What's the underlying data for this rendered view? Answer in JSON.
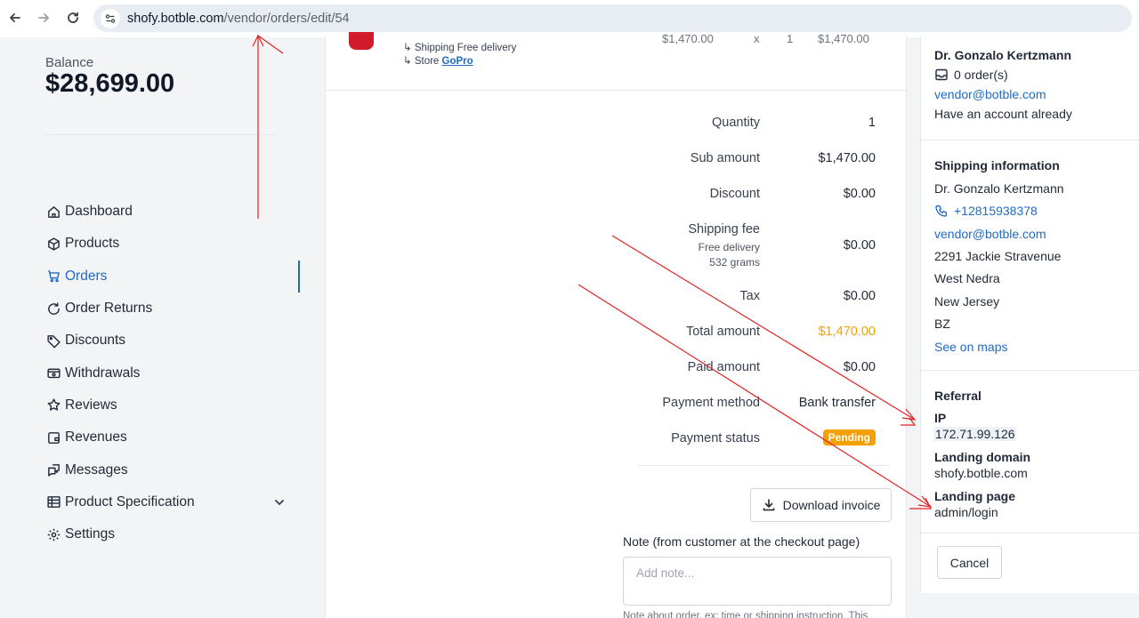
{
  "browser": {
    "url_host": "shofy.botble.com",
    "url_path": "/vendor/orders/edit/54"
  },
  "sidebar": {
    "balance_label": "Balance",
    "balance_value": "$28,699.00",
    "items": [
      {
        "label": "Dashboard",
        "icon": "home-icon"
      },
      {
        "label": "Products",
        "icon": "package-icon"
      },
      {
        "label": "Orders",
        "icon": "cart-icon",
        "active": true
      },
      {
        "label": "Order Returns",
        "icon": "return-icon"
      },
      {
        "label": "Discounts",
        "icon": "tag-icon"
      },
      {
        "label": "Withdrawals",
        "icon": "wallet-icon"
      },
      {
        "label": "Reviews",
        "icon": "star-icon"
      },
      {
        "label": "Revenues",
        "icon": "revenue-icon"
      },
      {
        "label": "Messages",
        "icon": "messages-icon"
      },
      {
        "label": "Product Specification",
        "icon": "table-icon"
      },
      {
        "label": "Settings",
        "icon": "gear-icon"
      }
    ]
  },
  "product": {
    "shipping_line": "↳ Shipping Free delivery",
    "store_prefix": "↳ Store",
    "store_name": "GoPro",
    "cut_price": "$1,470.00",
    "cut_times": "x",
    "cut_qty": "1",
    "cut_total": "$1,470.00"
  },
  "summary": {
    "quantity_label": "Quantity",
    "quantity_value": "1",
    "sub_amount_label": "Sub amount",
    "sub_amount_value": "$1,470.00",
    "discount_label": "Discount",
    "discount_value": "$0.00",
    "shipping_fee_label": "Shipping fee",
    "shipping_method": "Free delivery",
    "shipping_weight": "532 grams",
    "shipping_fee_value": "$0.00",
    "tax_label": "Tax",
    "tax_value": "$0.00",
    "total_label": "Total amount",
    "total_value": "$1,470.00",
    "paid_label": "Paid amount",
    "paid_value": "$0.00",
    "payment_method_label": "Payment method",
    "payment_method_value": "Bank transfer",
    "payment_status_label": "Payment status",
    "payment_status_value": "Pending"
  },
  "actions": {
    "download_invoice": "Download invoice",
    "note_label": "Note (from customer at the checkout page)",
    "note_placeholder": "Add note...",
    "note_help": "Note about order, ex: time or shipping instruction. This",
    "cancel": "Cancel"
  },
  "customer": {
    "name": "Dr. Gonzalo Kertzmann",
    "orders": "0 order(s)",
    "email": "vendor@botble.com",
    "account_status": "Have an account already"
  },
  "shipping_info": {
    "title": "Shipping information",
    "name": "Dr. Gonzalo Kertzmann",
    "phone": "+12815938378",
    "email": "vendor@botble.com",
    "address": "2291 Jackie Stravenue",
    "city": "West Nedra",
    "state": "New Jersey",
    "country": "BZ",
    "maps_link": "See on maps"
  },
  "referral": {
    "title": "Referral",
    "ip_label": "IP",
    "ip_value": "172.71.99.126",
    "domain_label": "Landing domain",
    "domain_value": "shofy.botble.com",
    "page_label": "Landing page",
    "page_value": "admin/login"
  },
  "colors": {
    "accent": "#206bc4",
    "warning": "#f59f00",
    "annotation": "#e02424"
  }
}
